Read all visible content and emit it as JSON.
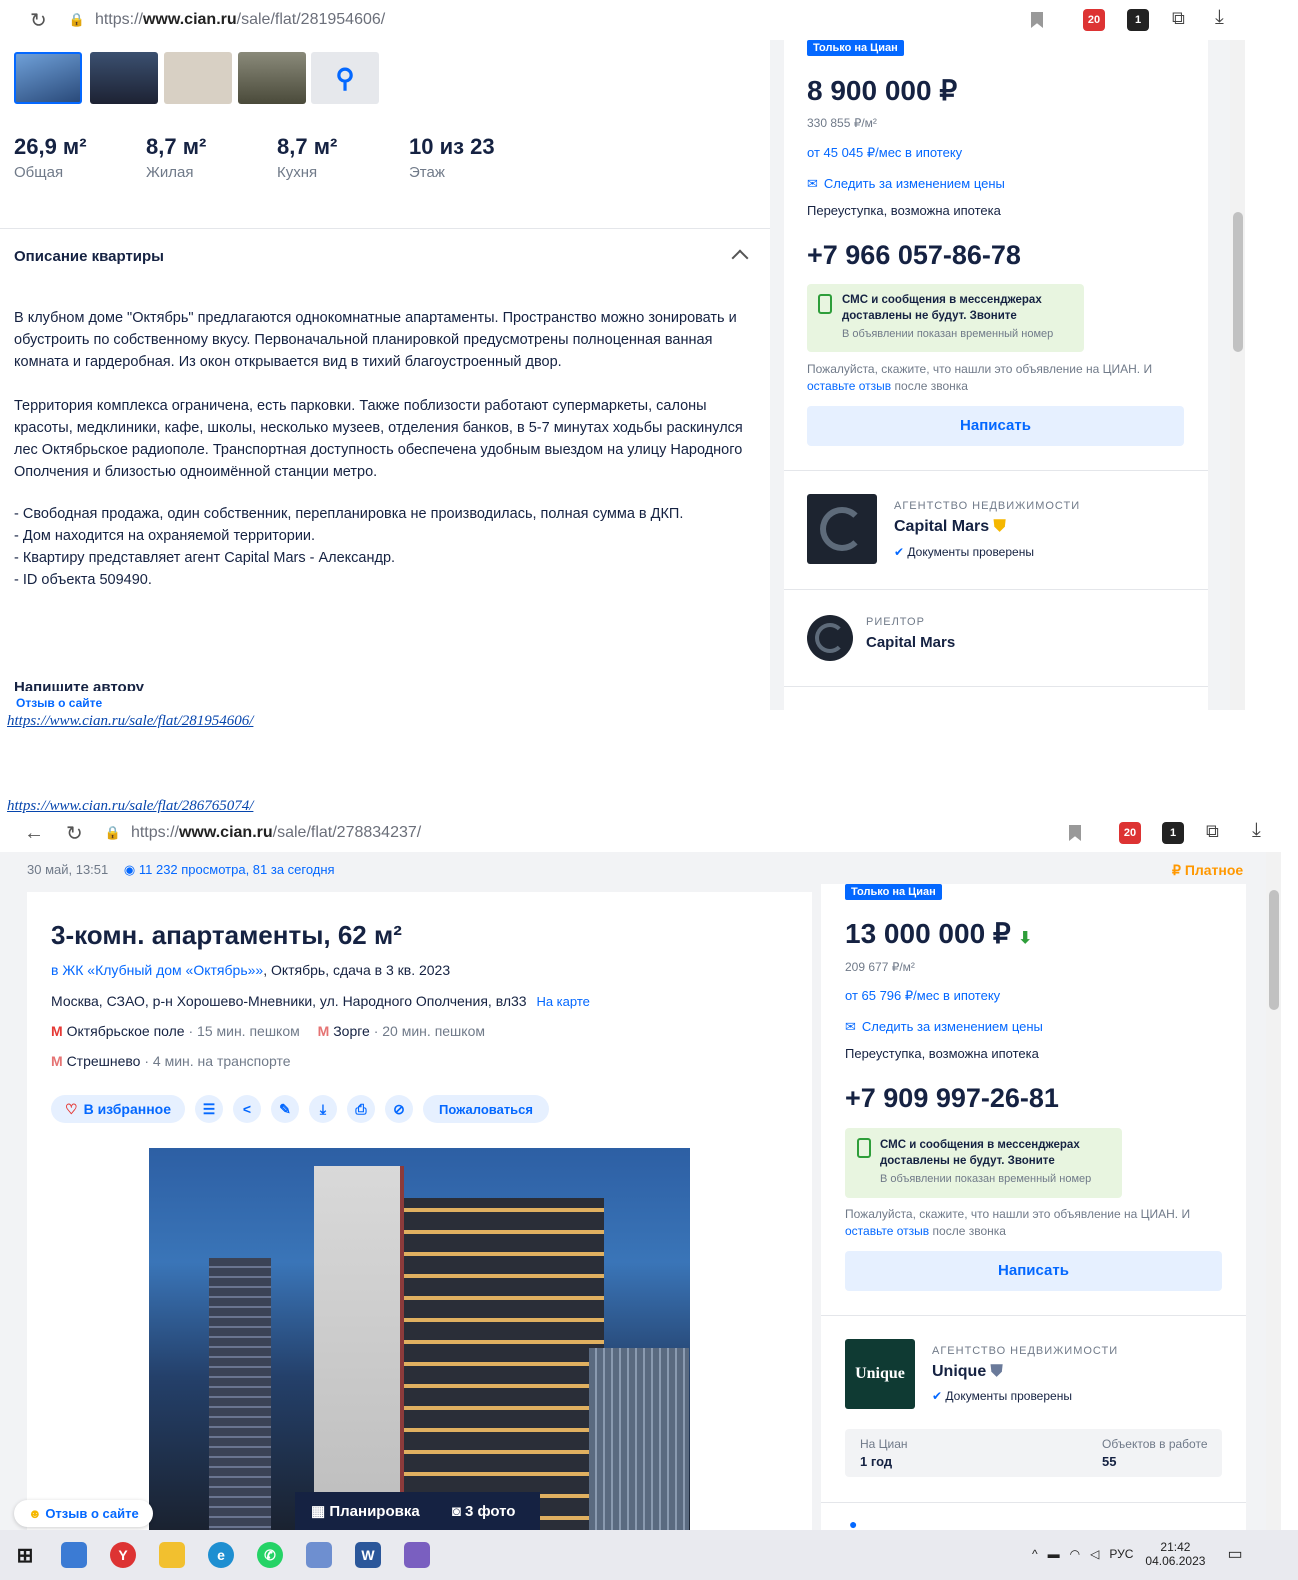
{
  "s1": {
    "url_prefix": "https://",
    "url_host": "www.cian.ru",
    "url_path": "/sale/flat/281954606/",
    "ext_badge_1": "20",
    "ext_badge_2": "1",
    "stats": [
      {
        "value": "26,9 м²",
        "label": "Общая"
      },
      {
        "value": "8,7 м²",
        "label": "Жилая"
      },
      {
        "value": "8,7 м²",
        "label": "Кухня"
      },
      {
        "value": "10 из 23",
        "label": "Этаж"
      }
    ],
    "desc_title": "Описание квартиры",
    "desc_p1": "В клубном доме \"Октябрь\" предлагаются однокомнатные апартаменты. Пространство можно зонировать и обустроить по собственному вкусу. Первоначальной планировкой предусмотрены полноценная ванная комната и гардеробная. Из окон открывается вид в тихий благоустроенный двор.",
    "desc_p2": "Территория комплекса ограничена, есть парковки. Также поблизости работают супермаркеты, салоны красоты, медклиники, кафе, школы, несколько музеев, отделения банков, в 5-7 минутах ходьбы раскинулся лес Октябрьское радиополе. Транспортная доступность обеспечена удобным выездом на улицу Народного Ополчения и близостью одноимённой станции метро.",
    "desc_l1": " - Свободная продажа, один собственник, перепланировка не производилась, полная сумма в ДКП.",
    "desc_l2": " - Дом находится на охраняемой территории.",
    "desc_l3": " - Квартиру представляет агент Capital Mars - Александр.",
    "desc_l4": " - ID объекта 509490.",
    "write_author": "Напишите автору",
    "feedback": "Отзыв о сайте",
    "tag": "Только на Циан",
    "price": "8 900 000 ₽",
    "price_m2": "330 855 ₽/м²",
    "mortgage": "от 45 045 ₽/мес в ипотеку",
    "follow": "Следить за изменением цены",
    "deal": "Переуступка, возможна ипотека",
    "phone": "+7 966 057-86-78",
    "sms1": "СМС и сообщения в мессенджерах",
    "sms2": "доставлены не будут. Звоните",
    "sms3": "В объявлении показан временный номер",
    "please1": "Пожалуйста, скажите, что нашли это объявление на ЦИАН. И",
    "please_link": "оставьте отзыв",
    "please2": " после звонка",
    "write": "Написать",
    "agency_type": "АГЕНТСТВО НЕДВИЖИМОСТИ",
    "agency_name": "Capital Mars",
    "verified": "Документы проверены",
    "realtor_type": "РИЕЛТОР",
    "realtor_name": "Capital Mars"
  },
  "link1": "https://www.cian.ru/sale/flat/281954606/",
  "link2": "https://www.cian.ru/sale/flat/286765074/",
  "s2": {
    "url_prefix": "https://",
    "url_host": "www.cian.ru",
    "url_path": "/sale/flat/278834237/",
    "ext_badge_1": "20",
    "ext_badge_2": "1",
    "date": "30 май, 13:51",
    "views": "11 232 просмотра, 81 за сегодня",
    "paid": "Платное",
    "title": "3-комн. апартаменты, 62 м²",
    "jk_link": "в ЖК «Клубный дом «Октябрь»»",
    "jk_rest": ", Октябрь, сдача в 3 кв. 2023",
    "address": "Москва, СЗАО, р-н Хорошево-Мневники, ул. Народного Ополчения, вл33",
    "on_map": "На карте",
    "metro1": "Октябрьское поле",
    "metro1_t": " · 15 мин. пешком",
    "metro2": "Зорге",
    "metro2_t": " · 20 мин. пешком",
    "metro3": "Стрешнево",
    "metro3_t": " · 4 мин. на транспорте",
    "favorite": "В избранное",
    "complain": "Пожаловаться",
    "plan_btn": "Планировка",
    "photo_btn": "3 фото",
    "feedback": "Отзыв о сайте",
    "tag": "Только на Циан",
    "price": "13 000 000 ₽",
    "price_m2": "209 677 ₽/м²",
    "mortgage": "от 65 796 ₽/мес в ипотеку",
    "follow": "Следить за изменением цены",
    "deal": "Переуступка, возможна ипотека",
    "phone": "+7 909 997-26-81",
    "sms1": "СМС и сообщения в мессенджерах",
    "sms2": "доставлены не будут. Звоните",
    "sms3": "В объявлении показан временный номер",
    "please1": "Пожалуйста, скажите, что нашли это объявление на ЦИАН. И",
    "please_link": "оставьте отзыв",
    "please2": " после звонка",
    "write": "Написать",
    "agency_type": "АГЕНТСТВО НЕДВИЖИМОСТИ",
    "agency_name": "Unique",
    "agency_logo": "Unique",
    "verified": "Документы проверены",
    "on_cian_l": "На Циан",
    "on_cian_v": "1 год",
    "objects_l": "Объектов в работе",
    "objects_v": "55"
  },
  "taskbar": {
    "lang": "РУС",
    "time": "21:42",
    "date": "04.06.2023"
  },
  "colors": {
    "accent": "#0468ff",
    "metro": "#e53935",
    "paid": "#ff9800",
    "notice": "#e8f5e0"
  }
}
